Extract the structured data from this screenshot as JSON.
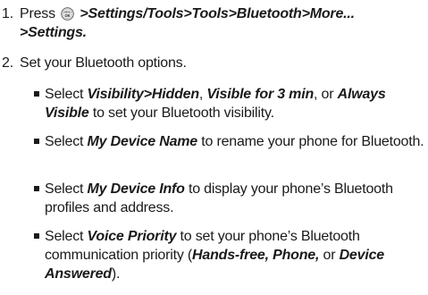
{
  "step1": {
    "number": "1.",
    "prefix": "Press",
    "key_icon": "menu-ok-key-icon",
    "key_label_top": "MENU",
    "key_label_bottom": "OK",
    "path_line1": ">Settings/Tools>Tools>Bluetooth>More...",
    "path_line2": ">Settings."
  },
  "step2": {
    "number": "2.",
    "text": "Set your Bluetooth options."
  },
  "bullets": [
    {
      "pre": "Select ",
      "term1": "Visibility",
      "sep1": ">",
      "term2": "Hidden",
      "sep2": ", ",
      "term3": "Visible for 3 min",
      "sep3": ", or ",
      "term4": "Always Visible",
      "post": " to set your Bluetooth visibility."
    },
    {
      "pre": "Select ",
      "term": "My Device Name",
      "post": " to rename your phone for Bluetooth."
    },
    {
      "pre": "Select ",
      "term": "My Device Info",
      "post": " to display your phone’s Bluetooth profiles and address."
    },
    {
      "pre": "Select ",
      "term": "Voice Priority",
      "post": " to set your phone’s Bluetooth communication priority (",
      "opt1": "Hands-free, Phone,",
      "mid": " or ",
      "opt2": "Device Answered",
      "end": ")."
    }
  ]
}
